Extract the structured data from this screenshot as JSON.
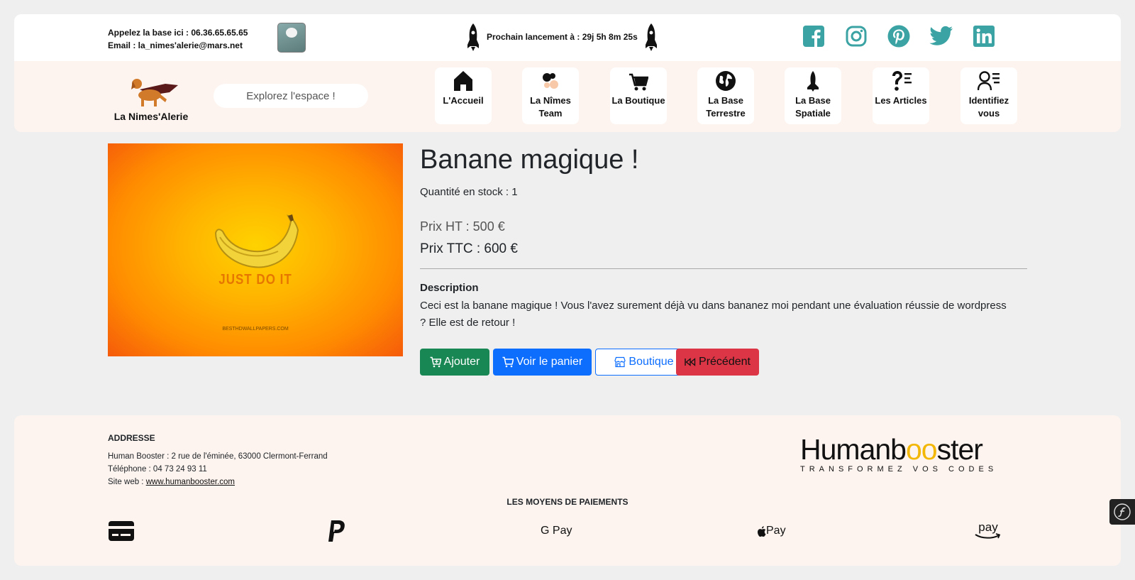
{
  "topbar": {
    "phone": "Appelez la base ici : 06.36.65.65.65",
    "email": "Email : la_nimes'alerie@mars.net",
    "launch_text": "Prochain lancement à : 29j 5h 8m 25s",
    "socials": [
      "facebook-icon",
      "instagram-icon",
      "pinterest-icon",
      "twitter-icon",
      "linkedin-icon"
    ]
  },
  "nav": {
    "brand": "La Nimes'Alerie",
    "search_placeholder": "Explorez l'espace !",
    "items": [
      {
        "icon": "home-icon",
        "label": "L'Accueil"
      },
      {
        "icon": "team-icon",
        "label": "La Nîmes Team"
      },
      {
        "icon": "cart-icon",
        "label": "La Boutique"
      },
      {
        "icon": "globe-icon",
        "label": "La Base Terrestre"
      },
      {
        "icon": "rocket-icon",
        "label": "La Base Spatiale"
      },
      {
        "icon": "articles-icon",
        "label": "Les Articles"
      },
      {
        "icon": "user-list-icon",
        "label": "Identifiez vous"
      }
    ]
  },
  "product": {
    "title": "Banane magique !",
    "stock": "Quantité en stock : 1",
    "price_ht": "Prix HT : 500 €",
    "price_ttc": "Prix TTC : 600 €",
    "description_heading": "Description",
    "description": "Ceci est la banane magique ! Vous l'avez surement déjà vu dans bananez moi pendant une évaluation réussie de wordpress ? Elle est de retour !",
    "image_slogan": "JUST DO IT",
    "image_watermark": "BESTHDWALLPAPERS.COM"
  },
  "actions": {
    "add": "Ajouter",
    "view_cart": "Voir le panier",
    "shop": "Boutique",
    "previous": "Précédent"
  },
  "footer": {
    "address_heading": "ADDRESSE",
    "address_line": "Human Booster : 2 rue de l'éminée, 63000 Clermont-Ferrand",
    "phone_line": "Téléphone : 04 73 24 93 11",
    "site_prefix": "Site web : ",
    "site_link": "www.humanbooster.com",
    "brand_part1": "Humanb",
    "brand_oo": "oo",
    "brand_part2": "ster",
    "brand_tagline": "TRANSFORMEZ VOS CODES",
    "payments_heading": "LES MOYENS DE PAIEMENTS",
    "payments": {
      "gpay": "G Pay",
      "applepay": "Pay",
      "amazonpay": "pay"
    }
  },
  "colors": {
    "success": "#198754",
    "primary": "#0d6efd",
    "danger": "#dc3545",
    "social": "#3ba3a3",
    "nav_bg": "#fdf4ef"
  }
}
